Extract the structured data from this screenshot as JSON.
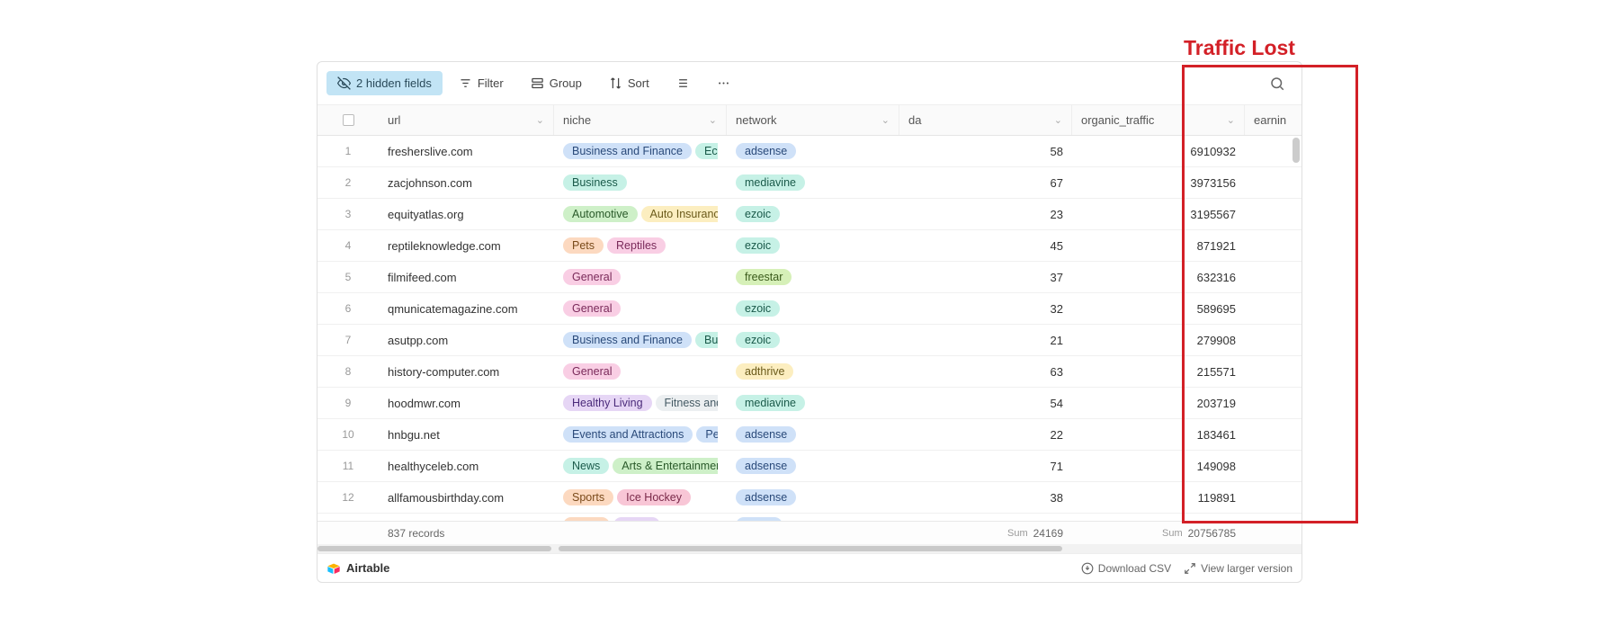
{
  "annotation": "Traffic Lost",
  "toolbar": {
    "hidden_fields": "2 hidden fields",
    "filter": "Filter",
    "group": "Group",
    "sort": "Sort"
  },
  "columns": {
    "url": "url",
    "niche": "niche",
    "network": "network",
    "da": "da",
    "organic_traffic": "organic_traffic",
    "earning": "earnin"
  },
  "rows": [
    {
      "n": "1",
      "url": "fresherslive.com",
      "niche": [
        {
          "t": "Business and Finance",
          "c": "c-blue"
        },
        {
          "t": "Econ",
          "c": "c-teal"
        }
      ],
      "network": [
        {
          "t": "adsense",
          "c": "c-blue"
        }
      ],
      "da": "58",
      "traffic": "6910932"
    },
    {
      "n": "2",
      "url": "zacjohnson.com",
      "niche": [
        {
          "t": "Business",
          "c": "c-teal"
        }
      ],
      "network": [
        {
          "t": "mediavine",
          "c": "c-teal"
        }
      ],
      "da": "67",
      "traffic": "3973156"
    },
    {
      "n": "3",
      "url": "equityatlas.org",
      "niche": [
        {
          "t": "Automotive",
          "c": "c-green"
        },
        {
          "t": "Auto Insuranc",
          "c": "c-yellow"
        }
      ],
      "network": [
        {
          "t": "ezoic",
          "c": "c-teal"
        }
      ],
      "da": "23",
      "traffic": "3195567"
    },
    {
      "n": "4",
      "url": "reptileknowledge.com",
      "niche": [
        {
          "t": "Pets",
          "c": "c-orange"
        },
        {
          "t": "Reptiles",
          "c": "c-pink"
        }
      ],
      "network": [
        {
          "t": "ezoic",
          "c": "c-teal"
        }
      ],
      "da": "45",
      "traffic": "871921"
    },
    {
      "n": "5",
      "url": "filmifeed.com",
      "niche": [
        {
          "t": "General",
          "c": "c-pink"
        }
      ],
      "network": [
        {
          "t": "freestar",
          "c": "c-lime"
        }
      ],
      "da": "37",
      "traffic": "632316"
    },
    {
      "n": "6",
      "url": "qmunicatemagazine.com",
      "niche": [
        {
          "t": "General",
          "c": "c-pink"
        }
      ],
      "network": [
        {
          "t": "ezoic",
          "c": "c-teal"
        }
      ],
      "da": "32",
      "traffic": "589695"
    },
    {
      "n": "7",
      "url": "asutpp.com",
      "niche": [
        {
          "t": "Business and Finance",
          "c": "c-blue"
        },
        {
          "t": "Busi",
          "c": "c-teal"
        }
      ],
      "network": [
        {
          "t": "ezoic",
          "c": "c-teal"
        }
      ],
      "da": "21",
      "traffic": "279908"
    },
    {
      "n": "8",
      "url": "history-computer.com",
      "niche": [
        {
          "t": "General",
          "c": "c-pink"
        }
      ],
      "network": [
        {
          "t": "adthrive",
          "c": "c-yellow"
        }
      ],
      "da": "63",
      "traffic": "215571"
    },
    {
      "n": "9",
      "url": "hoodmwr.com",
      "niche": [
        {
          "t": "Healthy Living",
          "c": "c-purple"
        },
        {
          "t": "Fitness and",
          "c": "c-grey"
        }
      ],
      "network": [
        {
          "t": "mediavine",
          "c": "c-teal"
        }
      ],
      "da": "54",
      "traffic": "203719"
    },
    {
      "n": "10",
      "url": "hnbgu.net",
      "niche": [
        {
          "t": "Events and Attractions",
          "c": "c-blue"
        },
        {
          "t": "Per",
          "c": "c-blue"
        }
      ],
      "network": [
        {
          "t": "adsense",
          "c": "c-blue"
        }
      ],
      "da": "22",
      "traffic": "183461"
    },
    {
      "n": "11",
      "url": "healthyceleb.com",
      "niche": [
        {
          "t": "News",
          "c": "c-teal"
        },
        {
          "t": "Arts & Entertainmen",
          "c": "c-green"
        }
      ],
      "network": [
        {
          "t": "adsense",
          "c": "c-blue"
        }
      ],
      "da": "71",
      "traffic": "149098"
    },
    {
      "n": "12",
      "url": "allfamousbirthday.com",
      "niche": [
        {
          "t": "Sports",
          "c": "c-orange"
        },
        {
          "t": "Ice Hockey",
          "c": "c-rose"
        }
      ],
      "network": [
        {
          "t": "adsense",
          "c": "c-blue"
        }
      ],
      "da": "38",
      "traffic": "119891"
    }
  ],
  "peek_row": {
    "niche": [
      {
        "t": " ",
        "c": "c-orange"
      },
      {
        "t": " ",
        "c": "c-purple"
      }
    ],
    "network": [
      {
        "t": " ",
        "c": "c-blue"
      }
    ]
  },
  "summary": {
    "records": "837 records",
    "sum_label": "Sum",
    "da_sum": "24169",
    "traffic_sum": "20756785"
  },
  "footer": {
    "brand": "Airtable",
    "download": "Download CSV",
    "larger": "View larger version"
  }
}
